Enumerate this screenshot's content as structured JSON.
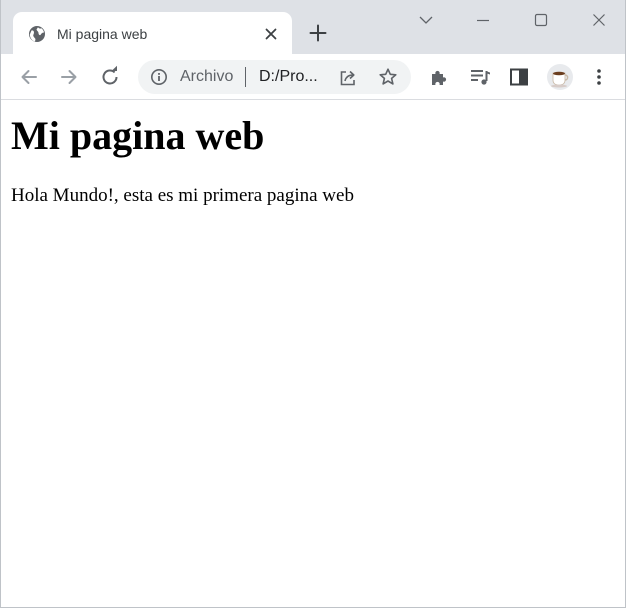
{
  "tab": {
    "title": "Mi pagina web",
    "favicon": "globe-icon"
  },
  "omnibox": {
    "security_label": "Archivo",
    "url": "D:/Pro..."
  },
  "page": {
    "heading": "Mi pagina web",
    "paragraph": "Hola Mundo!, esta es mi primera pagina web"
  },
  "colors": {
    "tabstrip_bg": "#dee1e6",
    "omnibox_bg": "#f1f3f4",
    "icon": "#5f6368"
  }
}
